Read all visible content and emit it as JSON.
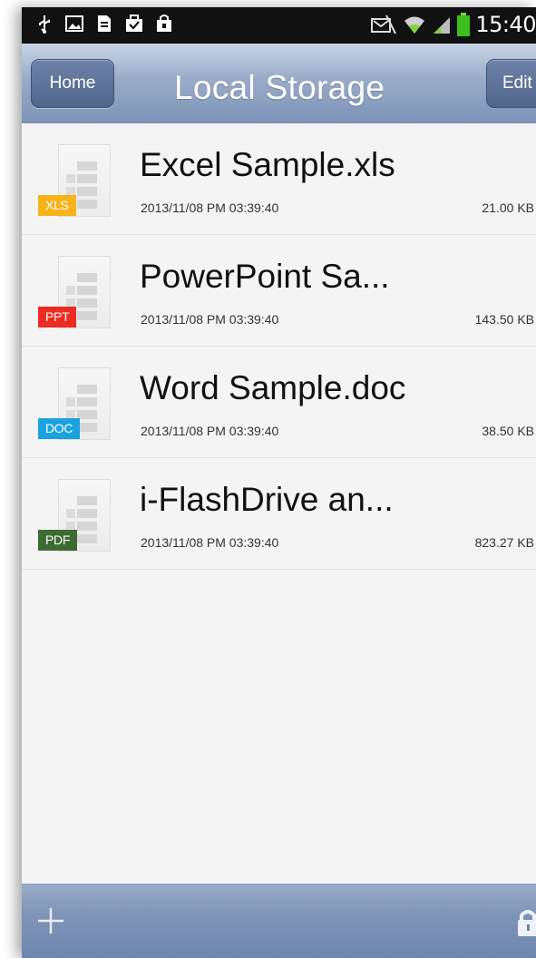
{
  "status_bar": {
    "time": "15:40",
    "left_icons": [
      "usb-icon",
      "image-icon",
      "document-icon",
      "briefcase-icon",
      "shopping-bag-icon"
    ],
    "right_icons": [
      "mute-icon",
      "wifi-icon",
      "signal-icon",
      "battery-icon"
    ]
  },
  "header": {
    "title": "Local Storage",
    "home_label": "Home",
    "edit_label": "Edit"
  },
  "files": [
    {
      "name": "Excel Sample.xls",
      "date": "2013/11/08 PM 03:39:40",
      "size": "21.00 KB",
      "type": "XLS",
      "badge_color": "#f7b31a"
    },
    {
      "name": "PowerPoint Sa...",
      "date": "2013/11/08 PM 03:39:40",
      "size": "143.50 KB",
      "type": "PPT",
      "badge_color": "#ee2b20"
    },
    {
      "name": "Word Sample.doc",
      "date": "2013/11/08 PM 03:39:40",
      "size": "38.50 KB",
      "type": "DOC",
      "badge_color": "#1aa3e0"
    },
    {
      "name": "i-FlashDrive an...",
      "date": "2013/11/08 PM 03:39:40",
      "size": "823.27 KB",
      "type": "PDF",
      "badge_color": "#3d6b33"
    }
  ],
  "bottom_bar": {
    "add_icon": "plus-icon",
    "lock_icon": "lock-icon"
  },
  "colors": {
    "header_gradient_top": "#c9d4e6",
    "header_gradient_bottom": "#7d93b7",
    "list_background": "#f4f4f4"
  }
}
